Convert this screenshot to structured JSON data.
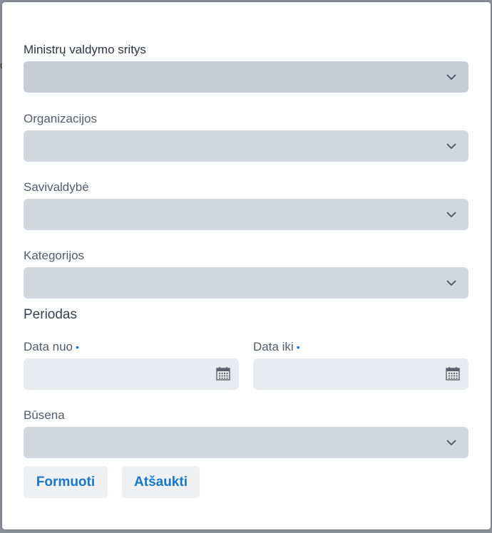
{
  "background": {
    "peek_text": "u"
  },
  "dialog": {
    "fields": {
      "ministries": {
        "label": "Ministrų valdymo sritys",
        "value": ""
      },
      "organizations": {
        "label": "Organizacijos",
        "value": ""
      },
      "municipality": {
        "label": "Savivaldybė",
        "value": ""
      },
      "categories": {
        "label": "Kategorijos",
        "value": ""
      }
    },
    "period": {
      "title": "Periodas",
      "date_from": {
        "label": "Data nuo",
        "required_marker": "•",
        "value": ""
      },
      "date_to": {
        "label": "Data iki",
        "required_marker": "•",
        "value": ""
      }
    },
    "status": {
      "label": "Būsena",
      "value": ""
    },
    "buttons": {
      "submit": "Formuoti",
      "cancel": "Atšaukti"
    }
  },
  "colors": {
    "accent": "#1877c9",
    "required": "#1a73e8",
    "select_bg": "#d2d6df",
    "date_bg": "#e7eaef",
    "button_bg": "#eef0f4"
  },
  "icons": {
    "dropdown": "chevron-down-icon",
    "date": "calendar-icon"
  }
}
